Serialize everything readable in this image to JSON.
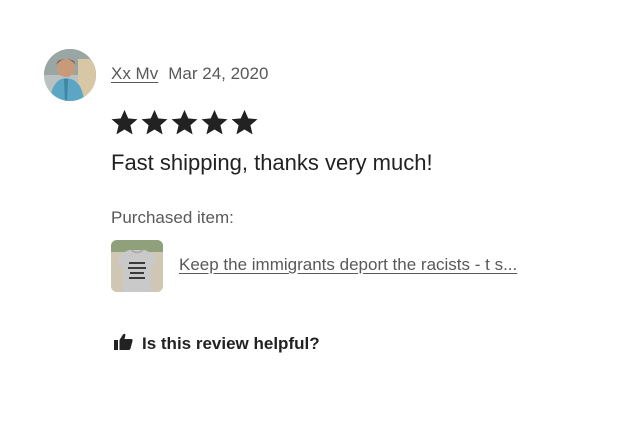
{
  "review": {
    "reviewer_name": "Xx Mv",
    "date": "Mar 24, 2020",
    "rating": 5,
    "rating_max": 5,
    "text": "Fast shipping, thanks very much!",
    "purchased_label": "Purchased item:",
    "item_title": "Keep the immigrants deport the racists - t s...",
    "helpful_label": "Is this review helpful?"
  },
  "icons": {
    "star": "star-icon",
    "helpful": "thumbs-up-icon"
  },
  "colors": {
    "text": "#222222",
    "muted": "#595959",
    "star": "#222222"
  }
}
